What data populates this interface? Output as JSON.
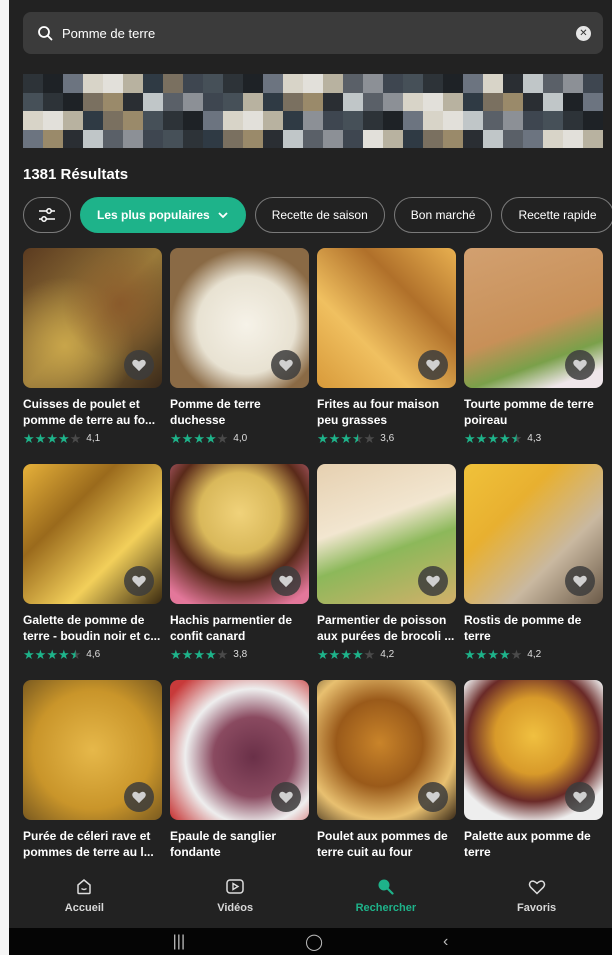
{
  "search": {
    "query": "Pomme de terre"
  },
  "results_label": "1381 Résultats",
  "filters": {
    "active": "Les plus populaires",
    "chips": [
      "Recette de saison",
      "Bon marché",
      "Recette rapide"
    ]
  },
  "recipes": [
    {
      "title": "Cuisses de poulet et pomme de terre au fo...",
      "rating": "4,1",
      "stars": 4
    },
    {
      "title": "Pomme de terre duchesse",
      "rating": "4,0",
      "stars": 4
    },
    {
      "title": "Frites au four maison peu grasses",
      "rating": "3,6",
      "stars": 3.5
    },
    {
      "title": "Tourte pomme de terre poireau",
      "rating": "4,3",
      "stars": 4.5
    },
    {
      "title": "Galette de pomme de terre - boudin noir et c...",
      "rating": "4,6",
      "stars": 4.5
    },
    {
      "title": "Hachis parmentier de confit canard",
      "rating": "3,8",
      "stars": 4
    },
    {
      "title": "Parmentier de poisson aux purées de brocoli ...",
      "rating": "4,2",
      "stars": 4
    },
    {
      "title": "Rostis de pomme de terre",
      "rating": "4,2",
      "stars": 4
    },
    {
      "title": "Purée de céleri rave et pommes de terre au l...",
      "rating": "",
      "stars": 0
    },
    {
      "title": "Epaule de sanglier fondante",
      "rating": "",
      "stars": 0
    },
    {
      "title": "Poulet aux pommes de terre cuit au four",
      "rating": "",
      "stars": 0
    },
    {
      "title": "Palette aux pomme de terre",
      "rating": "",
      "stars": 0
    }
  ],
  "nav": {
    "home": "Accueil",
    "videos": "Vidéos",
    "search": "Rechercher",
    "favorites": "Favoris"
  },
  "colors": {
    "accent": "#1eb38a",
    "background": "#222222"
  }
}
